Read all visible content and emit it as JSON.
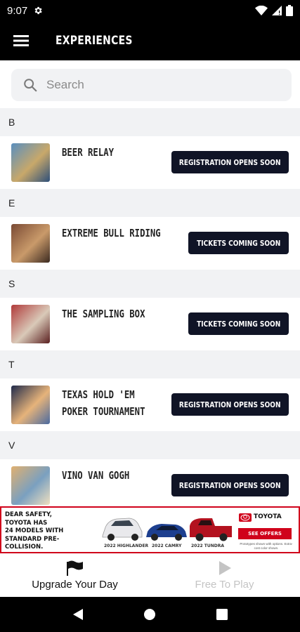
{
  "status_bar": {
    "time": "9:07"
  },
  "app_bar": {
    "title": "EXPERIENCES"
  },
  "search": {
    "placeholder": "Search"
  },
  "sections": [
    {
      "letter": "B",
      "items": [
        {
          "title_lines": [
            "BEER RELAY"
          ],
          "action": "REGISTRATION OPENS SOON",
          "thumb_colors": [
            "#5a8fbf",
            "#c8a86a",
            "#2d4f7a"
          ]
        }
      ]
    },
    {
      "letter": "E",
      "items": [
        {
          "title_lines": [
            "EXTREME BULL RIDING"
          ],
          "action": "TICKETS COMING SOON",
          "thumb_colors": [
            "#7a4a34",
            "#c99a6a",
            "#3b2a20"
          ]
        }
      ]
    },
    {
      "letter": "S",
      "items": [
        {
          "title_lines": [
            "THE SAMPLING BOX"
          ],
          "action": "TICKETS COMING SOON",
          "thumb_colors": [
            "#b03a3a",
            "#d9c9b8",
            "#5a1f1f"
          ]
        }
      ]
    },
    {
      "letter": "T",
      "items": [
        {
          "title_lines": [
            "TEXAS HOLD 'EM",
            "POKER TOURNAMENT"
          ],
          "action": "REGISTRATION OPENS SOON",
          "thumb_colors": [
            "#1f2a4a",
            "#e6b37a",
            "#4a6aa0"
          ]
        }
      ]
    },
    {
      "letter": "V",
      "items": [
        {
          "title_lines": [
            "VINO VAN GOGH"
          ],
          "action": "REGISTRATION OPENS SOON",
          "thumb_colors": [
            "#e0b070",
            "#7aa0c0",
            "#f0e0c0"
          ]
        }
      ]
    }
  ],
  "ad": {
    "headline_lines": [
      "DEAR SAFETY,",
      "TOYOTA HAS",
      "24 MODELS WITH",
      "STANDARD PRE-COLLISION."
    ],
    "car_labels": [
      "2022 HIGHLANDER",
      "2022 CAMRY",
      "2022 TUNDRA"
    ],
    "brand": "TOYOTA",
    "cta": "SEE OFFERS",
    "fine_print": "Prototypes shown with options. Extra-cost color shown.",
    "colors": {
      "border": "#d0021b",
      "cta": "#d0021b"
    }
  },
  "bottom_nav": {
    "items": [
      {
        "label": "Upgrade Your Day",
        "icon": "flag-icon",
        "active": true
      },
      {
        "label": "Free To Play",
        "icon": "play-icon",
        "active": false
      }
    ]
  },
  "colors": {
    "app_bar": "#000000",
    "button_bg": "#101426",
    "section_bg": "#f1f2f4"
  }
}
